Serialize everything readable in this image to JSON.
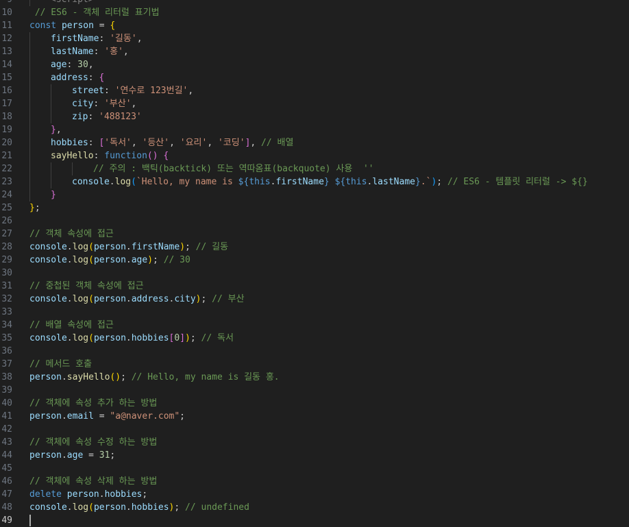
{
  "editor": {
    "lines": [
      {
        "n": "9",
        "ind": 1,
        "tokens": [
          [
            "tg",
            "<script>"
          ]
        ]
      },
      {
        "n": "10",
        "ind": 0,
        "tokens": [
          [
            "cm",
            " // ES6 - 객체 리터럴 표기법"
          ]
        ]
      },
      {
        "n": "11",
        "ind": 0,
        "tokens": [
          [
            "kw",
            "const "
          ],
          [
            "var",
            "person"
          ],
          [
            "pn",
            " = "
          ],
          [
            "b1",
            "{"
          ]
        ]
      },
      {
        "n": "12",
        "ind": 1,
        "tokens": [
          [
            "var",
            "firstName"
          ],
          [
            "pn",
            ": "
          ],
          [
            "str",
            "'길동'"
          ],
          [
            "pn",
            ","
          ]
        ]
      },
      {
        "n": "13",
        "ind": 1,
        "tokens": [
          [
            "var",
            "lastName"
          ],
          [
            "pn",
            ": "
          ],
          [
            "str",
            "'홍'"
          ],
          [
            "pn",
            ","
          ]
        ]
      },
      {
        "n": "14",
        "ind": 1,
        "tokens": [
          [
            "var",
            "age"
          ],
          [
            "pn",
            ": "
          ],
          [
            "num",
            "30"
          ],
          [
            "pn",
            ","
          ]
        ]
      },
      {
        "n": "15",
        "ind": 1,
        "tokens": [
          [
            "var",
            "address"
          ],
          [
            "pn",
            ": "
          ],
          [
            "b2",
            "{"
          ]
        ]
      },
      {
        "n": "16",
        "ind": 2,
        "tokens": [
          [
            "var",
            "street"
          ],
          [
            "pn",
            ": "
          ],
          [
            "str",
            "'연수로 123번길'"
          ],
          [
            "pn",
            ","
          ]
        ]
      },
      {
        "n": "17",
        "ind": 2,
        "tokens": [
          [
            "var",
            "city"
          ],
          [
            "pn",
            ": "
          ],
          [
            "str",
            "'부산'"
          ],
          [
            "pn",
            ","
          ]
        ]
      },
      {
        "n": "18",
        "ind": 2,
        "tokens": [
          [
            "var",
            "zip"
          ],
          [
            "pn",
            ": "
          ],
          [
            "str",
            "'488123'"
          ]
        ]
      },
      {
        "n": "19",
        "ind": 1,
        "tokens": [
          [
            "b2",
            "}"
          ],
          [
            "pn",
            ","
          ]
        ]
      },
      {
        "n": "20",
        "ind": 1,
        "tokens": [
          [
            "var",
            "hobbies"
          ],
          [
            "pn",
            ": "
          ],
          [
            "b2",
            "["
          ],
          [
            "str",
            "'독서'"
          ],
          [
            "pn",
            ", "
          ],
          [
            "str",
            "'등산'"
          ],
          [
            "pn",
            ", "
          ],
          [
            "str",
            "'요리'"
          ],
          [
            "pn",
            ", "
          ],
          [
            "str",
            "'코딩'"
          ],
          [
            "b2",
            "]"
          ],
          [
            "pn",
            ", "
          ],
          [
            "cm",
            "// 배열"
          ]
        ]
      },
      {
        "n": "21",
        "ind": 1,
        "tokens": [
          [
            "fn",
            "sayHello"
          ],
          [
            "pn",
            ": "
          ],
          [
            "kw",
            "function"
          ],
          [
            "b2",
            "()"
          ],
          [
            "pn",
            " "
          ],
          [
            "b2",
            "{"
          ]
        ]
      },
      {
        "n": "22",
        "ind": 3,
        "tokens": [
          [
            "cm",
            "// 주의 : 백틱(backtick) 또는 역따옴표(backquote) 사용  ''"
          ]
        ]
      },
      {
        "n": "23",
        "ind": 2,
        "tokens": [
          [
            "var",
            "console"
          ],
          [
            "pn",
            "."
          ],
          [
            "fn",
            "log"
          ],
          [
            "b3",
            "("
          ],
          [
            "str",
            "`Hello, my name is "
          ],
          [
            "kw",
            "${"
          ],
          [
            "kw",
            "this"
          ],
          [
            "pn",
            "."
          ],
          [
            "var",
            "firstName"
          ],
          [
            "kw",
            "}"
          ],
          [
            "str",
            " "
          ],
          [
            "kw",
            "${"
          ],
          [
            "kw",
            "this"
          ],
          [
            "pn",
            "."
          ],
          [
            "var",
            "lastName"
          ],
          [
            "kw",
            "}"
          ],
          [
            "str",
            ".`"
          ],
          [
            "b3",
            ")"
          ],
          [
            "pn",
            "; "
          ],
          [
            "cm",
            "// ES6 - 템플릿 리터럴 -> ${}"
          ]
        ]
      },
      {
        "n": "24",
        "ind": 1,
        "tokens": [
          [
            "b2",
            "}"
          ]
        ]
      },
      {
        "n": "25",
        "ind": 0,
        "tokens": [
          [
            "b1",
            "}"
          ],
          [
            "pn",
            ";"
          ]
        ]
      },
      {
        "n": "26",
        "ind": 0,
        "tokens": []
      },
      {
        "n": "27",
        "ind": 0,
        "tokens": [
          [
            "cm",
            "// 객체 속성에 접근"
          ]
        ]
      },
      {
        "n": "28",
        "ind": 0,
        "tokens": [
          [
            "var",
            "console"
          ],
          [
            "pn",
            "."
          ],
          [
            "fn",
            "log"
          ],
          [
            "b1",
            "("
          ],
          [
            "var",
            "person"
          ],
          [
            "pn",
            "."
          ],
          [
            "var",
            "firstName"
          ],
          [
            "b1",
            ")"
          ],
          [
            "pn",
            "; "
          ],
          [
            "cm",
            "// 길동"
          ]
        ]
      },
      {
        "n": "29",
        "ind": 0,
        "tokens": [
          [
            "var",
            "console"
          ],
          [
            "pn",
            "."
          ],
          [
            "fn",
            "log"
          ],
          [
            "b1",
            "("
          ],
          [
            "var",
            "person"
          ],
          [
            "pn",
            "."
          ],
          [
            "var",
            "age"
          ],
          [
            "b1",
            ")"
          ],
          [
            "pn",
            "; "
          ],
          [
            "cm",
            "// 30"
          ]
        ]
      },
      {
        "n": "30",
        "ind": 0,
        "tokens": []
      },
      {
        "n": "31",
        "ind": 0,
        "tokens": [
          [
            "cm",
            "// 중첩된 객체 속성에 접근"
          ]
        ]
      },
      {
        "n": "32",
        "ind": 0,
        "tokens": [
          [
            "var",
            "console"
          ],
          [
            "pn",
            "."
          ],
          [
            "fn",
            "log"
          ],
          [
            "b1",
            "("
          ],
          [
            "var",
            "person"
          ],
          [
            "pn",
            "."
          ],
          [
            "var",
            "address"
          ],
          [
            "pn",
            "."
          ],
          [
            "var",
            "city"
          ],
          [
            "b1",
            ")"
          ],
          [
            "pn",
            "; "
          ],
          [
            "cm",
            "// 부산"
          ]
        ]
      },
      {
        "n": "33",
        "ind": 0,
        "tokens": []
      },
      {
        "n": "34",
        "ind": 0,
        "tokens": [
          [
            "cm",
            "// 배열 속성에 접근"
          ]
        ]
      },
      {
        "n": "35",
        "ind": 0,
        "tokens": [
          [
            "var",
            "console"
          ],
          [
            "pn",
            "."
          ],
          [
            "fn",
            "log"
          ],
          [
            "b1",
            "("
          ],
          [
            "var",
            "person"
          ],
          [
            "pn",
            "."
          ],
          [
            "var",
            "hobbies"
          ],
          [
            "b2",
            "["
          ],
          [
            "num",
            "0"
          ],
          [
            "b2",
            "]"
          ],
          [
            "b1",
            ")"
          ],
          [
            "pn",
            "; "
          ],
          [
            "cm",
            "// 독서"
          ]
        ]
      },
      {
        "n": "36",
        "ind": 0,
        "tokens": []
      },
      {
        "n": "37",
        "ind": 0,
        "tokens": [
          [
            "cm",
            "// 메서드 호출"
          ]
        ]
      },
      {
        "n": "38",
        "ind": 0,
        "tokens": [
          [
            "var",
            "person"
          ],
          [
            "pn",
            "."
          ],
          [
            "fn",
            "sayHello"
          ],
          [
            "b1",
            "()"
          ],
          [
            "pn",
            "; "
          ],
          [
            "cm",
            "// Hello, my name is 길동 홍."
          ]
        ]
      },
      {
        "n": "39",
        "ind": 0,
        "tokens": []
      },
      {
        "n": "40",
        "ind": 0,
        "tokens": [
          [
            "cm",
            "// 객체에 속성 추가 하는 방법"
          ]
        ]
      },
      {
        "n": "41",
        "ind": 0,
        "tokens": [
          [
            "var",
            "person"
          ],
          [
            "pn",
            "."
          ],
          [
            "var",
            "email"
          ],
          [
            "pn",
            " = "
          ],
          [
            "str",
            "\"a@naver.com\""
          ],
          [
            "pn",
            ";"
          ]
        ]
      },
      {
        "n": "42",
        "ind": 0,
        "tokens": []
      },
      {
        "n": "43",
        "ind": 0,
        "tokens": [
          [
            "cm",
            "// 객체에 속성 수정 하는 방법"
          ]
        ]
      },
      {
        "n": "44",
        "ind": 0,
        "tokens": [
          [
            "var",
            "person"
          ],
          [
            "pn",
            "."
          ],
          [
            "var",
            "age"
          ],
          [
            "pn",
            " = "
          ],
          [
            "num",
            "31"
          ],
          [
            "pn",
            ";"
          ]
        ]
      },
      {
        "n": "45",
        "ind": 0,
        "tokens": []
      },
      {
        "n": "46",
        "ind": 0,
        "tokens": [
          [
            "cm",
            "// 객체에 속성 삭제 하는 방법"
          ]
        ]
      },
      {
        "n": "47",
        "ind": 0,
        "tokens": [
          [
            "kw",
            "delete "
          ],
          [
            "var",
            "person"
          ],
          [
            "pn",
            "."
          ],
          [
            "var",
            "hobbies"
          ],
          [
            "pn",
            ";"
          ]
        ]
      },
      {
        "n": "48",
        "ind": 0,
        "tokens": [
          [
            "var",
            "console"
          ],
          [
            "pn",
            "."
          ],
          [
            "fn",
            "log"
          ],
          [
            "b1",
            "("
          ],
          [
            "var",
            "person"
          ],
          [
            "pn",
            "."
          ],
          [
            "var",
            "hobbies"
          ],
          [
            "b1",
            ")"
          ],
          [
            "pn",
            "; "
          ],
          [
            "cm",
            "// undefined"
          ]
        ]
      },
      {
        "n": "49",
        "ind": 0,
        "tokens": [],
        "current": true
      }
    ]
  }
}
